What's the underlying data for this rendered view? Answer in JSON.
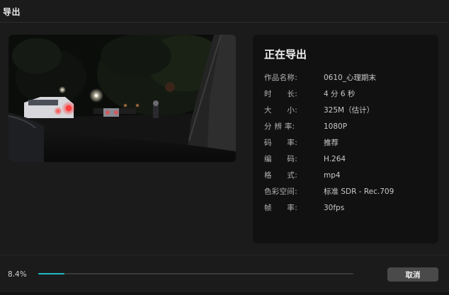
{
  "window": {
    "title": "导出"
  },
  "status": {
    "heading": "正在导出"
  },
  "info": [
    {
      "label": "作品名称:",
      "value": "0610_心理期末"
    },
    {
      "label": "时　　长:",
      "value": "4 分 6 秒"
    },
    {
      "label": "大　　小:",
      "value": "325M（估计）"
    },
    {
      "label": "分 辨 率:",
      "value": "1080P"
    },
    {
      "label": "码　　率:",
      "value": "推荐"
    },
    {
      "label": "编　　码:",
      "value": "H.264"
    },
    {
      "label": "格　　式:",
      "value": "mp4"
    },
    {
      "label": "色彩空间:",
      "value": "标准 SDR - Rec.709"
    },
    {
      "label": "帧　　率:",
      "value": "30fps"
    }
  ],
  "progress": {
    "text": "8.4%",
    "fraction": 0.084
  },
  "cancel_label": "取消",
  "colors": {
    "accent": "#1fb8c9",
    "background": "#1b1b1b",
    "panel": "#111111",
    "button": "#4a4a4a"
  }
}
